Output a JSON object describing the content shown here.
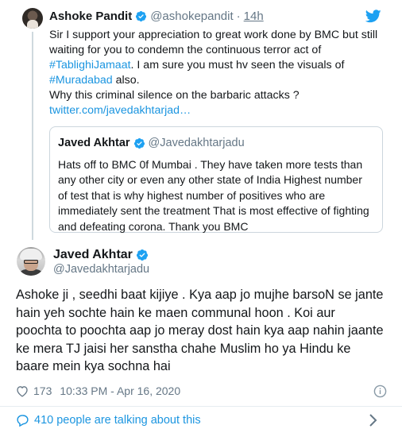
{
  "parent_tweet": {
    "name": "Ashoke Pandit",
    "handle": "@ashokepandit",
    "time_separator": "·",
    "time": "14h",
    "lines": [
      {
        "parts": [
          {
            "text": "Sir I support your appreciation to great work done by BMC but still",
            "link": false
          }
        ]
      },
      {
        "parts": [
          {
            "text": "waiting for you  to condemn the continuous  terror act of",
            "link": false
          }
        ]
      },
      {
        "parts": [
          {
            "text": "#TablighiJamaat",
            "link": true
          },
          {
            "text": ". I am sure you must hv seen the visuals of",
            "link": false
          }
        ]
      },
      {
        "parts": [
          {
            "text": "#Muradabad",
            "link": true
          },
          {
            "text": " also.",
            "link": false
          }
        ]
      },
      {
        "parts": [
          {
            "text": "Why this criminal silence on the barbaric attacks ?",
            "link": false
          }
        ]
      },
      {
        "parts": [
          {
            "text": "twitter.com/javedakhtarjad…",
            "link": true
          }
        ]
      }
    ]
  },
  "quoted_tweet": {
    "name": "Javed Akhtar",
    "handle": "@Javedakhtarjadu",
    "lines": [
      "Hats off to BMC 0f Mumbai . They have taken more tests than",
      "any other city or even any other state of India Highest number",
      "of test that is why highest number of positives who are",
      "immediately sent the treatment That is most effective of fighting",
      "and defeating corona. Thank you BMC"
    ]
  },
  "main_tweet": {
    "name": "Javed Akhtar",
    "handle": "@Javedakhtarjadu",
    "lines": [
      "Ashoke ji , seedhi baat kijiye . Kya aap jo mujhe barsoN se jante",
      "hain yeh sochte  hain ke maen communal hoon . Koi aur",
      "poochta to poochta aap jo meray dost hain kya aap nahin jaante",
      "ke mera TJ jaisi her sanstha chahe  Muslim ho ya Hindu ke",
      "baare mein kya sochna hai"
    ],
    "likes": "173",
    "timestamp": "10:33 PM - Apr 16, 2020"
  },
  "footer": {
    "talking_text": "410 people are talking about this"
  },
  "colors": {
    "link": "#1b95e0",
    "verified": "#1da1f2",
    "secondary_text": "#657786",
    "border": "#ccd6dd"
  },
  "icons": [
    "verified-badge-icon",
    "twitter-bird-icon",
    "heart-icon",
    "info-icon",
    "comment-bubble-icon",
    "chevron-right-icon"
  ]
}
